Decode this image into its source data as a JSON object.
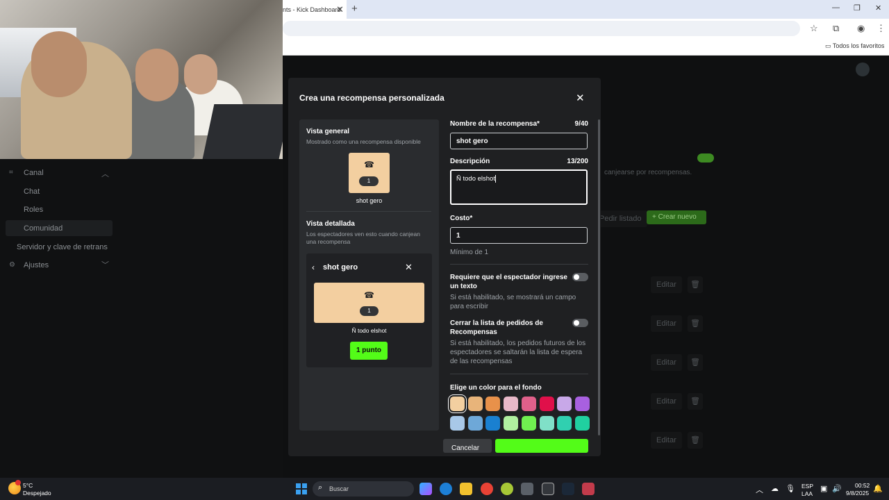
{
  "browser": {
    "tab_title": "nts - Kick Dashboard",
    "tab_close": "✕",
    "new_tab": "+",
    "bookmarks_label": "Todos los favoritos"
  },
  "sidebar": {
    "items": [
      {
        "label": "Canal",
        "icon": "grid-icon"
      },
      {
        "label": "Chat"
      },
      {
        "label": "Roles"
      },
      {
        "label": "Comunidad"
      },
      {
        "label": "Servidor y clave de retrans"
      },
      {
        "label": "Ajustes",
        "icon": "gear-icon"
      }
    ]
  },
  "background": {
    "canjearse_text": "canjearse por recompensas.",
    "pedir_listado": "Pedir listado",
    "crear_nuevo": "Crear nuevo",
    "editar": "Editar"
  },
  "modal": {
    "title": "Crea una recompensa personalizada",
    "close": "✕",
    "preview": {
      "general_title": "Vista general",
      "general_sub": "Mostrado como una recompensa disponible",
      "reward_name": "shot gero",
      "cost": "1",
      "detail_title": "Vista detallada",
      "detail_sub": "Los espectadores ven esto cuando canjean una recompensa",
      "detail_header": "shot gero",
      "detail_description": "Ñ todo elshot",
      "point_button": "1 punto"
    },
    "form": {
      "name_label": "Nombre de la recompensa*",
      "name_counter": "9/40",
      "name_value": "shot gero",
      "desc_label": "Descripción",
      "desc_counter": "13/200",
      "desc_value": "Ñ todo elshot",
      "cost_label": "Costo*",
      "cost_value": "1",
      "cost_hint": "Mínimo de 1",
      "require_text_label": "Requiere que el espectador ingrese un texto",
      "require_text_hint": "Si está habilitado, se mostrará un campo para escribir",
      "require_text_on": false,
      "close_list_label": "Cerrar la lista de pedidos de Recompensas",
      "close_list_hint": "Si está habilitado, los pedidos futuros de los espectadores se saltarán la lista de espera de las recompensas",
      "close_list_on": false,
      "color_label": "Elige un color para el fondo",
      "colors": [
        "#f3cfa0",
        "#e8b47a",
        "#e8914a",
        "#e8b8c8",
        "#e0608a",
        "#e0104a",
        "#c8a8e8",
        "#a860e0",
        "#a8c8e8",
        "#6ea8d8",
        "#1a80d0",
        "#b0f0a0",
        "#70f050",
        "#80e0c8",
        "#30d0b0",
        "#20d0a0"
      ],
      "selected_color_index": 0,
      "cancel_label": "Cancelar"
    }
  },
  "taskbar": {
    "temperature": "5°C",
    "weather": "Despejado",
    "search_placeholder": "Buscar",
    "lang_top": "ESP",
    "lang_bottom": "LAA",
    "time": "00:52",
    "date": "9/8/2025"
  }
}
